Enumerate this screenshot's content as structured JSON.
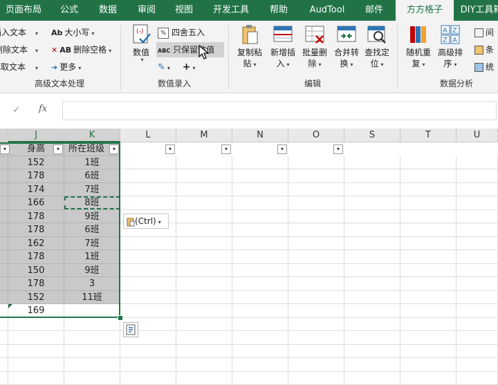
{
  "tabs": [
    "页面布局",
    "公式",
    "数据",
    "审阅",
    "视图",
    "开发工具",
    "帮助",
    "AudTool",
    "邮件",
    "方方格子",
    "DIY工具箱"
  ],
  "active_tab": "方方格子",
  "ribbon": {
    "text_group": {
      "items": [
        "插入文本",
        "删除文本",
        "截取文本"
      ],
      "items2": [
        "大小写",
        "删除空格",
        "更多"
      ],
      "icon2": [
        "Ab",
        "AB"
      ],
      "label": "高级文本处理"
    },
    "value_group": {
      "numeric_label": "数值",
      "round_label": "四舍五入",
      "keep_value_label": "只保留数值",
      "label": "数值录入"
    },
    "edit_group": {
      "buttons": [
        {
          "line1": "复制粘",
          "line2": "贴"
        },
        {
          "line1": "新增插",
          "line2": "入"
        },
        {
          "line1": "批量删",
          "line2": "除"
        },
        {
          "line1": "合并转",
          "line2": "换"
        },
        {
          "line1": "查找定",
          "line2": "位"
        }
      ],
      "label": "编辑"
    },
    "analysis_group": {
      "buttons": [
        {
          "line1": "随机重",
          "line2": "复"
        },
        {
          "line1": "高级排",
          "line2": "序"
        }
      ],
      "small_items": [
        "间",
        "条",
        "统"
      ],
      "label": "数据分析"
    }
  },
  "formula_bar": {
    "cancel": "✓",
    "fx": "fx",
    "value": ""
  },
  "columns": [
    "J",
    "K",
    "L",
    "M",
    "N",
    "O",
    "S",
    "T",
    "U"
  ],
  "header_row": {
    "j": "身高",
    "k": "所在班级"
  },
  "rows": [
    {
      "j": "152",
      "k": "1班"
    },
    {
      "j": "178",
      "k": "6班"
    },
    {
      "j": "174",
      "k": "7班"
    },
    {
      "j": "166",
      "k": "8班"
    },
    {
      "j": "178",
      "k": "9班"
    },
    {
      "j": "178",
      "k": "6班"
    },
    {
      "j": "162",
      "k": "7班"
    },
    {
      "j": "178",
      "k": "1班"
    },
    {
      "j": "150",
      "k": "9班"
    },
    {
      "j": "178",
      "k": "3"
    },
    {
      "j": "152",
      "k": "11班"
    },
    {
      "j": "169",
      "k": ""
    }
  ],
  "paste_options": "(Ctrl)",
  "colors": {
    "brand": "#217346",
    "selection": "#217346",
    "shaded": "#c9c9c9"
  }
}
